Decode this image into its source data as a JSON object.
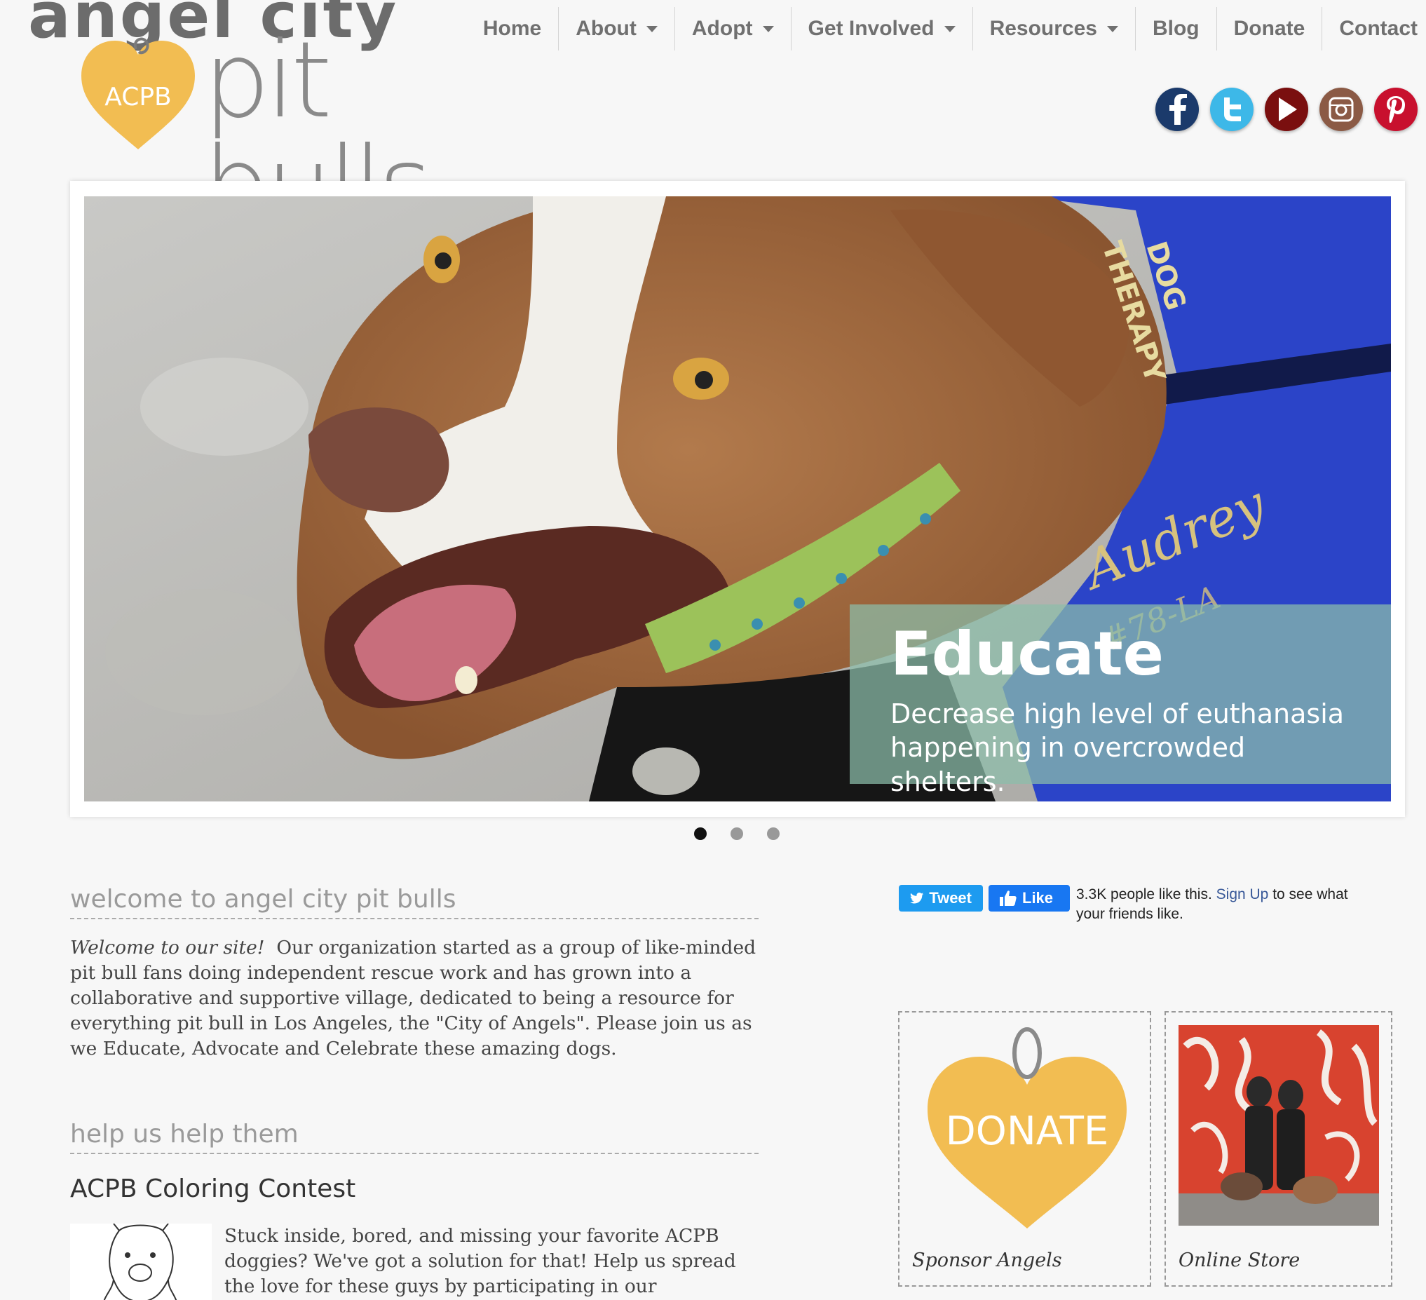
{
  "logo": {
    "top_text": "angel city",
    "badge_text": "ACPB",
    "bottom_text": "pit bulls",
    "heart_color": "#f2bd52"
  },
  "nav": {
    "items": [
      {
        "label": "Home",
        "dropdown": false
      },
      {
        "label": "About",
        "dropdown": true
      },
      {
        "label": "Adopt",
        "dropdown": true
      },
      {
        "label": "Get Involved",
        "dropdown": true
      },
      {
        "label": "Resources",
        "dropdown": true
      },
      {
        "label": "Blog",
        "dropdown": false
      },
      {
        "label": "Donate",
        "dropdown": false
      },
      {
        "label": "Contact",
        "dropdown": false
      }
    ]
  },
  "social": [
    {
      "icon": "facebook-icon",
      "color": "#1b3a6b"
    },
    {
      "icon": "twitter-icon",
      "color": "#3db8e8"
    },
    {
      "icon": "youtube-icon",
      "color": "#7a0f0f"
    },
    {
      "icon": "instagram-icon",
      "color": "#8b5a45"
    },
    {
      "icon": "pinterest-icon",
      "color": "#c8102e"
    }
  ],
  "slider": {
    "vest_word_1": "THERAPY",
    "vest_word_2": "DOG",
    "vest_name": "Audrey",
    "vest_tag": "#78-LA",
    "caption_title": "Educate",
    "caption_text": "Decrease high level of euthanasia happening in overcrowded shelters.",
    "active_dot": 1,
    "dot_count": 3
  },
  "welcome": {
    "title": "welcome to angel city pit bulls",
    "intro": "Welcome to our site!",
    "body": "Our organization started as a group of like-minded pit bull fans doing independent rescue work and has grown into a collaborative and supportive village, dedicated to being a resource for everything pit bull in Los Angeles, the \"City of Angels\". Please join us as we Educate, Advocate and Celebrate these amazing dogs."
  },
  "help": {
    "title": "help us help them",
    "contest_title": "ACPB Coloring Contest",
    "contest_text": "Stuck inside, bored, and missing your favorite ACPB doggies? We've got a solution for that! Help us spread the love for these guys by participating in our #ColorMyACPB contest!"
  },
  "share": {
    "tweet_label": "Tweet",
    "like_label": "Like",
    "fb_count_text": "3.3K people like this.",
    "fb_signup": "Sign Up",
    "fb_rest": "to see what your friends like."
  },
  "cards": {
    "donate_heart_text": "DONATE",
    "donate_label": "Sponsor Angels",
    "store_label": "Online Store"
  }
}
